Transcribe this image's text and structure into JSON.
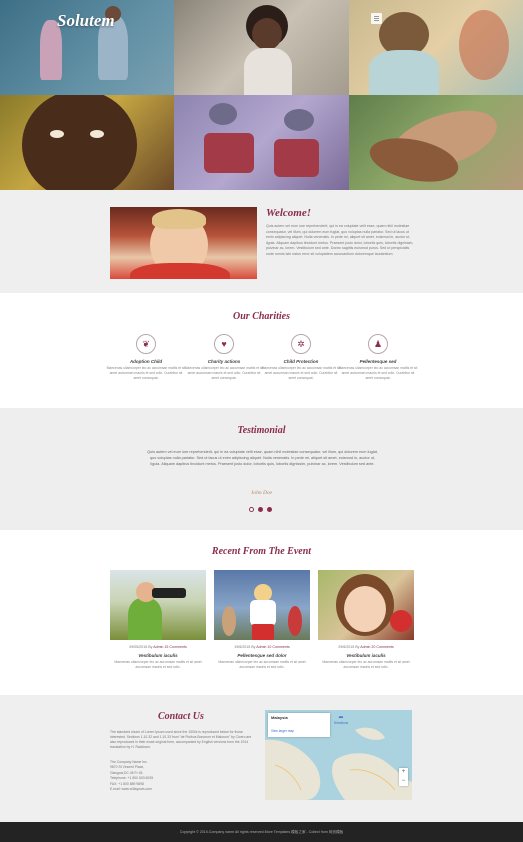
{
  "brand": {
    "logo": "Solutem"
  },
  "welcome": {
    "title": "Welcome!",
    "text": "Quis autem vel eum iure reprehenderit, qui in ea voluptate velit esse, quam nihil molestiae consequatur, vel illum, qui dolorem eum fugiat, quo voluptas nulla pariatur. Sed ut lacus ut enim adipiscing aliquet. Nulla venenatis. In pede mi, aliquet sit amet, euismod in, auctor ut, ligula. Aliquam dapibus tincidunt metus. Praesent justo dolor, lobortis quis, lobortis dignissim, pulvinar ac, lorem. Vestibulum sed ante. Donec sagittis euismod purus. Sed ut perspiciatis unde omnis iste natus error sit voluptatem accusantium doloremque laudantium."
  },
  "charities": {
    "title": "Our Charities",
    "items": [
      {
        "icon": "leaf-icon",
        "glyph": "❦",
        "label": "Adoption Child",
        "text": "Maecenas ullamcorper leo ac accumsan mattis et sit amet accumsan mauris et sed odio. Curabitur sit amet consequat."
      },
      {
        "icon": "heart-icon",
        "glyph": "♥",
        "label": "Charity actions",
        "text": "Maecenas ullamcorper leo ac accumsan mattis et sit amet accumsan mauris et sed odio. Curabitur sit amet consequat."
      },
      {
        "icon": "gear-icon",
        "glyph": "✲",
        "label": "Child Protection",
        "text": "Maecenas ullamcorper leo ac accumsan mattis et sit amet accumsan mauris et sed odio. Curabitur sit amet consequat."
      },
      {
        "icon": "user-icon",
        "glyph": "♟",
        "label": "Pellentesque sed",
        "text": "Maecenas ullamcorper leo ac accumsan mattis et sit amet accumsan mauris et sed odio. Curabitur sit amet consequat."
      }
    ]
  },
  "testimonial": {
    "title": "Testimonial",
    "text": "Quis autem vel eum iure reprehenderit, qui in ea voluptate velit esse, quam nihil molestiae consequatur, vel illum, qui dolorem eum fugiat, quo voluptas nulla pariatur. Sed ut lacus ut enim adipiscing aliquet. Nulla venenatis. In pede mi, aliquet sit amet, euismod in, auctor ut, ligula. Aliquam dapibus tincidunt metus. Praesent justo dolor, lobortis quis, lobortis dignissim, pulvinar ac, lorem. Vestibulum sed ante.",
    "author": "John Doe"
  },
  "events": {
    "title": "Recent From The Event",
    "items": [
      {
        "date": "09/05/2015",
        "by": "By",
        "author": "Admin",
        "comments": "15 Comments",
        "title": "Vestibulum iaculis",
        "text": "Maecenas ullamcorper leo ac accumsan mattis et sit amet accumsan mauris et sed odio."
      },
      {
        "date": "19/6/2015",
        "by": "By",
        "author": "Admin",
        "comments": "10 Comments",
        "title": "Pellentesque sed dolor",
        "text": "Maecenas ullamcorper leo ac accumsan mattis et sit amet accumsan mauris et sed odio."
      },
      {
        "date": "29/6/2015",
        "by": "By",
        "author": "Admin",
        "comments": "20 Comments",
        "title": "Vestibulum iaculis",
        "text": "Maecenas ullamcorper leo ac accumsan mattis et sit amet accumsan mauris et sed odio."
      }
    ]
  },
  "contact": {
    "title": "Contact Us",
    "text": "The standard chunk of Lorem Ipsum used since the 1500s is reproduced below for those interested. Sections 1.10.32 and 1.10.33 from \"de Finibus Bonorum et Malorum\" by Cicero are also reproduced in their exact original form, accompanied by English versions from the 1914 translation by H. Rackham.",
    "company": "The Company Name Inc.",
    "address1": "9870 St Vincent Place,",
    "address2": "Glasgow,DC 45 Fr 45.",
    "phone": "Telephone: +1 800 603 6035",
    "fax": "FAX: +1 800 889 9898",
    "email": "E-mail: www.w3layouts.com",
    "map_place": "Malaysia",
    "map_link": "View larger map",
    "map_directions": "Directions"
  },
  "footer": {
    "text": "Copyright © 2015.Company name All rights reserved.More Templates  模板之家 - Collect from 网页模板"
  },
  "colors": {
    "accent": "#8a2d4e",
    "footer_bg": "#232323"
  }
}
